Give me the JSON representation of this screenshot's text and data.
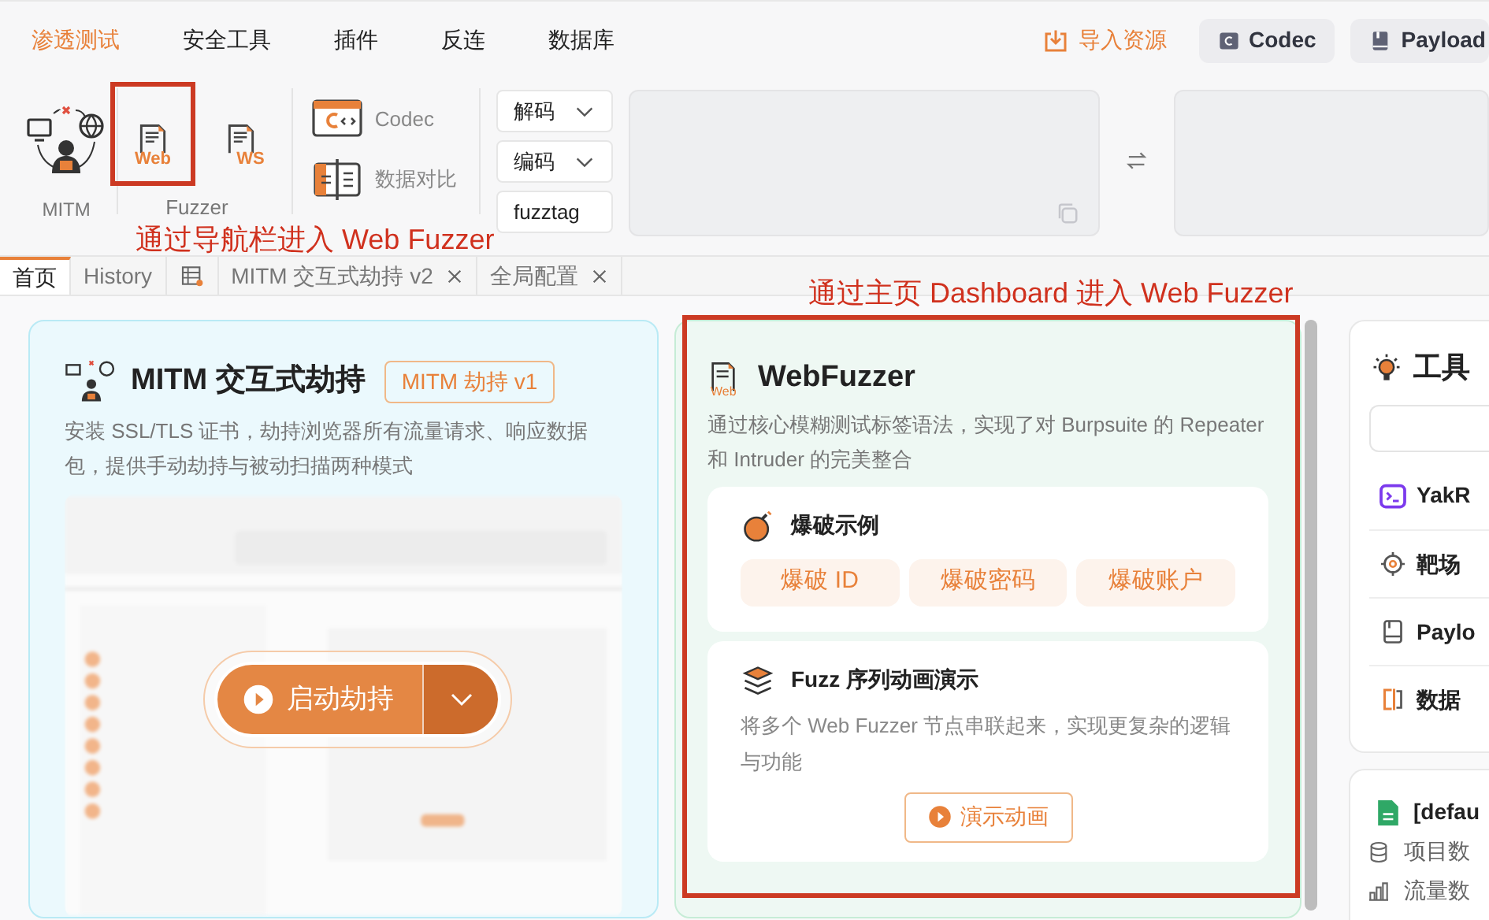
{
  "menu": [
    {
      "label": "渗透测试",
      "selected": true
    },
    {
      "label": "安全工具",
      "selected": false
    },
    {
      "label": "插件",
      "selected": false
    },
    {
      "label": "反连",
      "selected": false
    },
    {
      "label": "数据库",
      "selected": false
    }
  ],
  "top_actions": {
    "import": "导入资源",
    "buttons": [
      {
        "label": "Codec",
        "kind": "codec"
      },
      {
        "label": "Payload",
        "kind": "payload"
      }
    ]
  },
  "toolbar": {
    "mitm": {
      "label": "MITM"
    },
    "fuzzer": {
      "label": "Fuzzer",
      "tools": [
        {
          "text": "Web",
          "highlighted": true
        },
        {
          "text": "WS",
          "highlighted": false
        }
      ]
    },
    "codec_tools": [
      {
        "label": "Codec",
        "kind": "codec"
      },
      {
        "label": "数据对比",
        "kind": "compare"
      }
    ],
    "codec_actions": [
      {
        "label": "解码",
        "kind": "dropdown"
      },
      {
        "label": "编码",
        "kind": "dropdown"
      },
      {
        "label": "fuzztag",
        "kind": "button"
      }
    ]
  },
  "annotations": [
    "通过导航栏进入 Web Fuzzer",
    "通过主页 Dashboard 进入 Web Fuzzer"
  ],
  "tabs": [
    {
      "kind": "text",
      "label": "首页",
      "selected": true,
      "closable": false
    },
    {
      "kind": "text",
      "label": "History",
      "selected": false,
      "closable": false
    },
    {
      "kind": "icon",
      "selected": false,
      "closable": false
    },
    {
      "kind": "text",
      "label": "MITM 交互式劫持 v2",
      "selected": false,
      "closable": true
    },
    {
      "kind": "text",
      "label": "全局配置",
      "selected": false,
      "closable": true
    }
  ],
  "mitm_card": {
    "title": "MITM 交互式劫持",
    "badge": "MITM 劫持 v1",
    "description": "安装 SSL/TLS 证书，劫持浏览器所有流量请求、响应数据包，提供手动劫持与被动扫描两种模式",
    "start_button": "启动劫持"
  },
  "webfuzzer_card": {
    "icon_text": "Web",
    "title": "WebFuzzer",
    "description": "通过核心模糊测试标签语法，实现了对 Burpsuite 的 Repeater 和 Intruder 的完美整合",
    "highlighted": true,
    "sections": [
      {
        "kind": "buttons",
        "title": "爆破示例",
        "buttons": [
          "爆破 ID",
          "爆破密码",
          "爆破账户"
        ]
      },
      {
        "kind": "demo",
        "title": "Fuzz 序列动画演示",
        "description": "将多个 Web Fuzzer 节点串联起来，实现更复杂的逻辑与功能",
        "button": "演示动画"
      }
    ]
  },
  "tools_card": {
    "title": "工具",
    "items": [
      {
        "label": "YakR",
        "kind": "terminal"
      },
      {
        "label": "靶场",
        "kind": "target"
      },
      {
        "label": "Paylo",
        "kind": "book"
      },
      {
        "label": "数据",
        "kind": "compare"
      }
    ]
  },
  "project_card": {
    "title": "[defau",
    "items": [
      {
        "label": "项目数",
        "kind": "database"
      },
      {
        "label": "流量数",
        "kind": "chart"
      }
    ]
  }
}
